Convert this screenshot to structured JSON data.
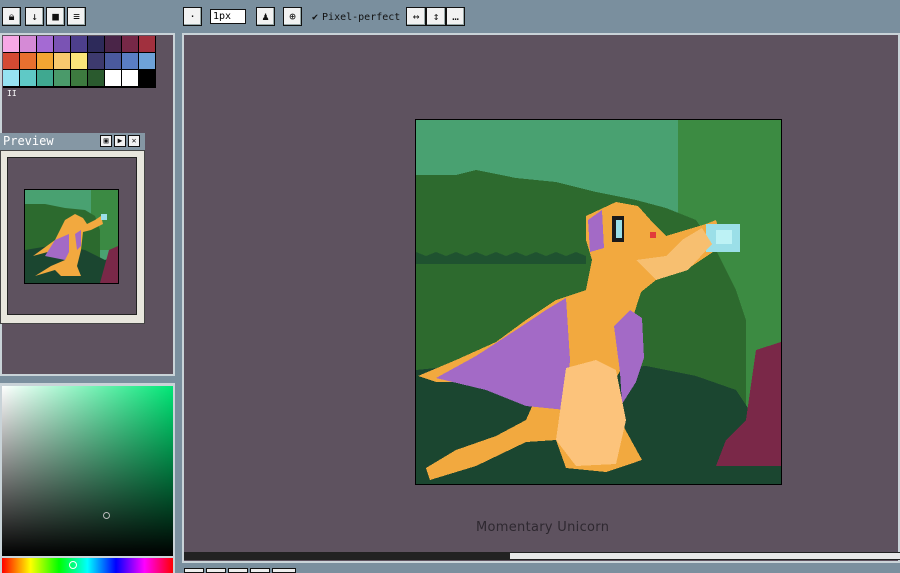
{
  "toolbar": {
    "left_buttons": [
      "lock-icon",
      "download-icon",
      "stop-icon",
      "menu-icon"
    ],
    "brush_size_value": "1px",
    "pixel_perfect_label": "Pixel-perfect",
    "pixel_perfect_checked": true
  },
  "palette": {
    "colors": [
      "#f7a8e6",
      "#d58ad6",
      "#a46ad3",
      "#7a53b4",
      "#4d3f8c",
      "#2d2a5a",
      "#4a2548",
      "#762847",
      "#a1303e",
      "#d44a33",
      "#e9702f",
      "#f3a532",
      "#f9c86e",
      "#fbe57a",
      "#3d3a6e",
      "#4a5a9e",
      "#5a7ec4",
      "#6ea2d8",
      "#96e3f2",
      "#5fc9c6",
      "#3fa890",
      "#4a9a6a",
      "#3d7a3f",
      "#2a5a2e",
      "#ffffff",
      "#ffffff",
      "#000000"
    ],
    "indicator": "II"
  },
  "preview": {
    "title": "Preview"
  },
  "canvas": {
    "watermark": "Momentary Unicorn"
  },
  "colors": {
    "app_bg": "#7a8f9e",
    "workspace": "#5e525f",
    "accent": "#ffffff"
  }
}
